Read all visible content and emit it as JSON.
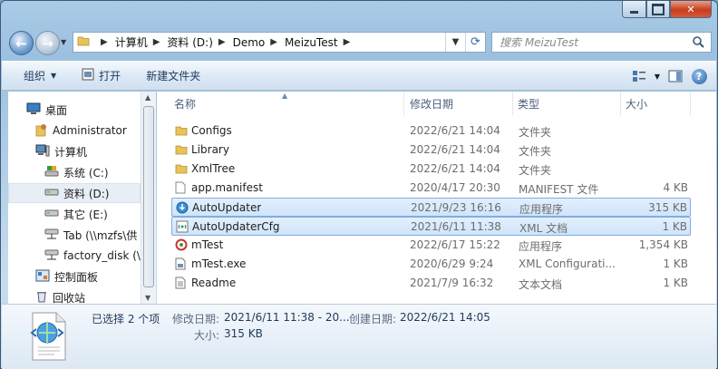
{
  "window": {
    "caption_buttons": [
      "minimize",
      "maximize",
      "close"
    ]
  },
  "address": {
    "crumbs": [
      "计算机",
      "资料 (D:)",
      "Demo",
      "MeizuTest"
    ]
  },
  "search": {
    "placeholder": "搜索 MeizuTest"
  },
  "toolbar": {
    "organize": "组织",
    "open": "打开",
    "new_folder": "新建文件夹"
  },
  "nav": {
    "items": [
      {
        "label": "桌面",
        "icon": "desktop-icon"
      },
      {
        "label": "Administrator",
        "icon": "user-folder-icon"
      },
      {
        "label": "计算机",
        "icon": "computer-icon"
      },
      {
        "label": "系统 (C:)",
        "icon": "system-drive-icon"
      },
      {
        "label": "资料 (D:)",
        "icon": "drive-icon",
        "selected": true
      },
      {
        "label": "其它 (E:)",
        "icon": "drive-icon"
      },
      {
        "label": "Tab (\\\\mzfs\\供",
        "icon": "network-drive-icon"
      },
      {
        "label": "factory_disk (\\\\",
        "icon": "network-drive-icon"
      },
      {
        "label": "控制面板",
        "icon": "control-panel-icon"
      },
      {
        "label": "回收站",
        "icon": "recycle-bin-icon"
      }
    ]
  },
  "columns": {
    "name": "名称",
    "date": "修改日期",
    "type": "类型",
    "size": "大小"
  },
  "files": [
    {
      "name": "Configs",
      "date": "2022/6/21 14:04",
      "type": "文件夹",
      "size": "",
      "icon": "folder-icon"
    },
    {
      "name": "Library",
      "date": "2022/6/21 14:04",
      "type": "文件夹",
      "size": "",
      "icon": "folder-icon"
    },
    {
      "name": "XmlTree",
      "date": "2022/6/21 14:04",
      "type": "文件夹",
      "size": "",
      "icon": "folder-icon"
    },
    {
      "name": "app.manifest",
      "date": "2020/4/17 20:30",
      "type": "MANIFEST 文件",
      "size": "4 KB",
      "icon": "file-icon"
    },
    {
      "name": "AutoUpdater",
      "date": "2021/9/23 16:16",
      "type": "应用程序",
      "size": "315 KB",
      "icon": "updater-app-icon",
      "selected": true
    },
    {
      "name": "AutoUpdaterCfg",
      "date": "2021/6/11 11:38",
      "type": "XML 文档",
      "size": "1 KB",
      "icon": "xml-file-icon",
      "selected": true
    },
    {
      "name": "mTest",
      "date": "2022/6/17 15:22",
      "type": "应用程序",
      "size": "1,354 KB",
      "icon": "app-icon"
    },
    {
      "name": "mTest.exe",
      "date": "2020/6/29 9:24",
      "type": "XML Configurati...",
      "size": "1 KB",
      "icon": "config-file-icon"
    },
    {
      "name": "Readme",
      "date": "2021/7/9 16:32",
      "type": "文本文档",
      "size": "1 KB",
      "icon": "text-file-icon"
    }
  ],
  "details": {
    "selection": "已选择 2 个项",
    "modified_label": "修改日期:",
    "modified_value": "2021/6/11 11:38 - 20...",
    "created_label": "创建日期:",
    "created_value": "2022/6/21 14:05",
    "size_label": "大小:",
    "size_value": "315 KB"
  }
}
